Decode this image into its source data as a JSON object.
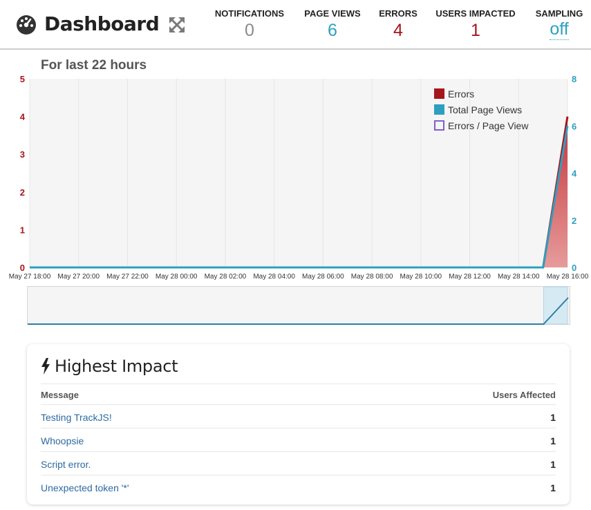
{
  "header": {
    "title": "Dashboard",
    "icons": {
      "title": "dashboard-gauge-icon",
      "expand": "expand-arrows-icon"
    },
    "stats": [
      {
        "label": "NOTIFICATIONS",
        "value": "0",
        "color": "#8a8a8a"
      },
      {
        "label": "PAGE VIEWS",
        "value": "6",
        "color": "#2e9fc0"
      },
      {
        "label": "ERRORS",
        "value": "4",
        "color": "#a6151b"
      },
      {
        "label": "USERS IMPACTED",
        "value": "1",
        "color": "#a6151b"
      },
      {
        "label": "SAMPLING",
        "value": "off",
        "color": "#2e9fc0"
      }
    ]
  },
  "chart": {
    "title": "For last 22 hours"
  },
  "chart_data": {
    "type": "area",
    "title": "For last 22 hours",
    "x": [
      "May 27 18:00",
      "May 27 20:00",
      "May 27 22:00",
      "May 28 00:00",
      "May 28 02:00",
      "May 28 04:00",
      "May 28 06:00",
      "May 28 08:00",
      "May 28 10:00",
      "May 28 12:00",
      "May 28 14:00",
      "May 28 16:00"
    ],
    "x_end_hours": 22,
    "y_left": {
      "ticks": [
        "0",
        "1",
        "2",
        "3",
        "4",
        "5"
      ],
      "range": [
        0,
        5
      ],
      "color": "#a6151b"
    },
    "y_right": {
      "ticks": [
        "0",
        "2",
        "4",
        "6",
        "8"
      ],
      "range": [
        0,
        8
      ],
      "color": "#2e9fc0"
    },
    "legend": [
      "Errors",
      "Total Page Views",
      "Errors / Page View"
    ],
    "legend_position": "top-right",
    "grid": true,
    "series": [
      {
        "name": "Errors",
        "axis": "left",
        "color": "#a6151b",
        "hours": [
          0,
          21,
          22
        ],
        "values": [
          0,
          0,
          4
        ]
      },
      {
        "name": "Total Page Views",
        "axis": "right",
        "color": "#2e9fc0",
        "hours": [
          0,
          21,
          22
        ],
        "values": [
          0,
          0,
          6
        ]
      },
      {
        "name": "Errors / Page View",
        "axis": "right",
        "color": "#7f5fc9",
        "hours": [],
        "values": []
      }
    ]
  },
  "impact": {
    "title": "Highest Impact",
    "icon": "lightning-bolt-icon",
    "headers": {
      "message": "Message",
      "users": "Users Affected"
    },
    "rows": [
      {
        "message": "Testing TrackJS!",
        "users": "1"
      },
      {
        "message": "Whoopsie",
        "users": "1"
      },
      {
        "message": "Script error.",
        "users": "1"
      },
      {
        "message": "Unexpected token '*'",
        "users": "1"
      }
    ]
  }
}
